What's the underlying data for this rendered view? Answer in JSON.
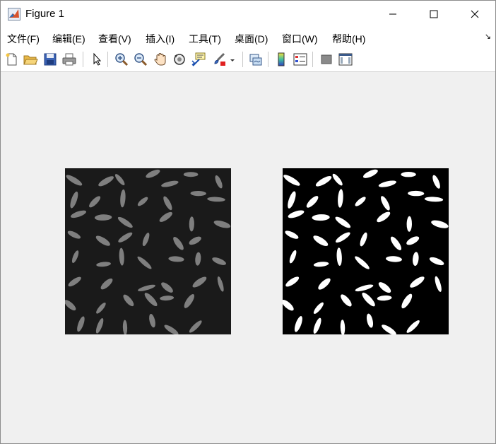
{
  "window": {
    "title": "Figure 1",
    "minimize_glyph": "—",
    "maximize_glyph": "☐",
    "close_glyph": "✕"
  },
  "menu": {
    "items": [
      {
        "label": "文件(F)"
      },
      {
        "label": "编辑(E)"
      },
      {
        "label": "查看(V)"
      },
      {
        "label": "插入(I)"
      },
      {
        "label": "工具(T)"
      },
      {
        "label": "桌面(D)"
      },
      {
        "label": "窗口(W)"
      },
      {
        "label": "帮助(H)"
      }
    ],
    "dock_arrow": "↘"
  },
  "toolbar": {
    "icons": [
      "new-figure-icon",
      "open-file-icon",
      "save-icon",
      "print-icon",
      "select-arrow-icon",
      "zoom-in-icon",
      "zoom-out-icon",
      "pan-hand-icon",
      "rotate-3d-icon",
      "data-cursor-icon",
      "brush-icon",
      "link-plot-icon",
      "colorbar-icon",
      "legend-icon",
      "hide-plot-tools-icon",
      "show-plot-tools-icon"
    ]
  },
  "colors": {
    "canvas_bg": "#f0f0f0",
    "image_bg": "#1a1a1a",
    "grain_gray": "#7f7f7f",
    "binary_bg": "#000000",
    "binary_fg": "#ffffff"
  },
  "axes": [
    {
      "name": "grayscale-rice-image"
    },
    {
      "name": "binary-rice-image"
    }
  ]
}
